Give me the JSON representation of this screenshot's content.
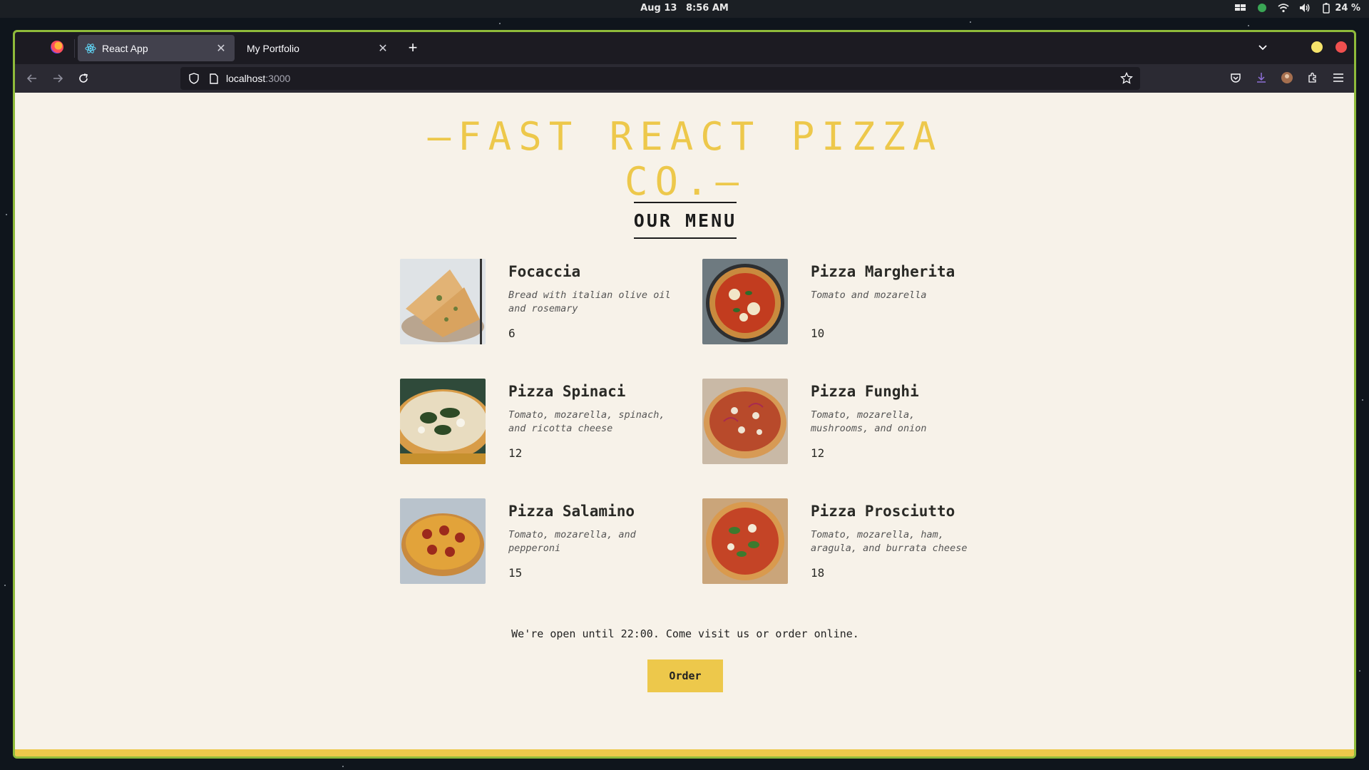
{
  "system_bar": {
    "date": "Aug 13",
    "time": "8:56 AM",
    "battery": "24 %",
    "icons": [
      "workspace-icon",
      "status-circle-icon",
      "wifi-icon",
      "volume-icon",
      "battery-icon"
    ]
  },
  "browser": {
    "tabs": [
      {
        "title": "React App",
        "active": true,
        "favicon": "react-icon"
      },
      {
        "title": "My Portfolio",
        "active": false
      }
    ],
    "url_host": "localhost",
    "url_port": ":3000",
    "accent_border": "#8fbb3a"
  },
  "page": {
    "brand": "—FAST REACT PIZZA CO.—",
    "menu_heading": "OUR MENU",
    "pizzas": [
      {
        "name": "Focaccia",
        "ingredients": "Bread with italian olive oil and rosemary",
        "price": "6"
      },
      {
        "name": "Pizza Margherita",
        "ingredients": "Tomato and mozarella",
        "price": "10"
      },
      {
        "name": "Pizza Spinaci",
        "ingredients": "Tomato, mozarella, spinach, and ricotta cheese",
        "price": "12"
      },
      {
        "name": "Pizza Funghi",
        "ingredients": "Tomato, mozarella, mushrooms, and onion",
        "price": "12"
      },
      {
        "name": "Pizza Salamino",
        "ingredients": "Tomato, mozarella, and pepperoni",
        "price": "15"
      },
      {
        "name": "Pizza Prosciutto",
        "ingredients": "Tomato, mozarella, ham, aragula, and burrata cheese",
        "price": "18"
      }
    ],
    "open_message": "We're open until 22:00. Come visit us or order online.",
    "order_button": "Order",
    "colors": {
      "brand_yellow": "#edc84b",
      "background": "#f7f2e9"
    }
  }
}
